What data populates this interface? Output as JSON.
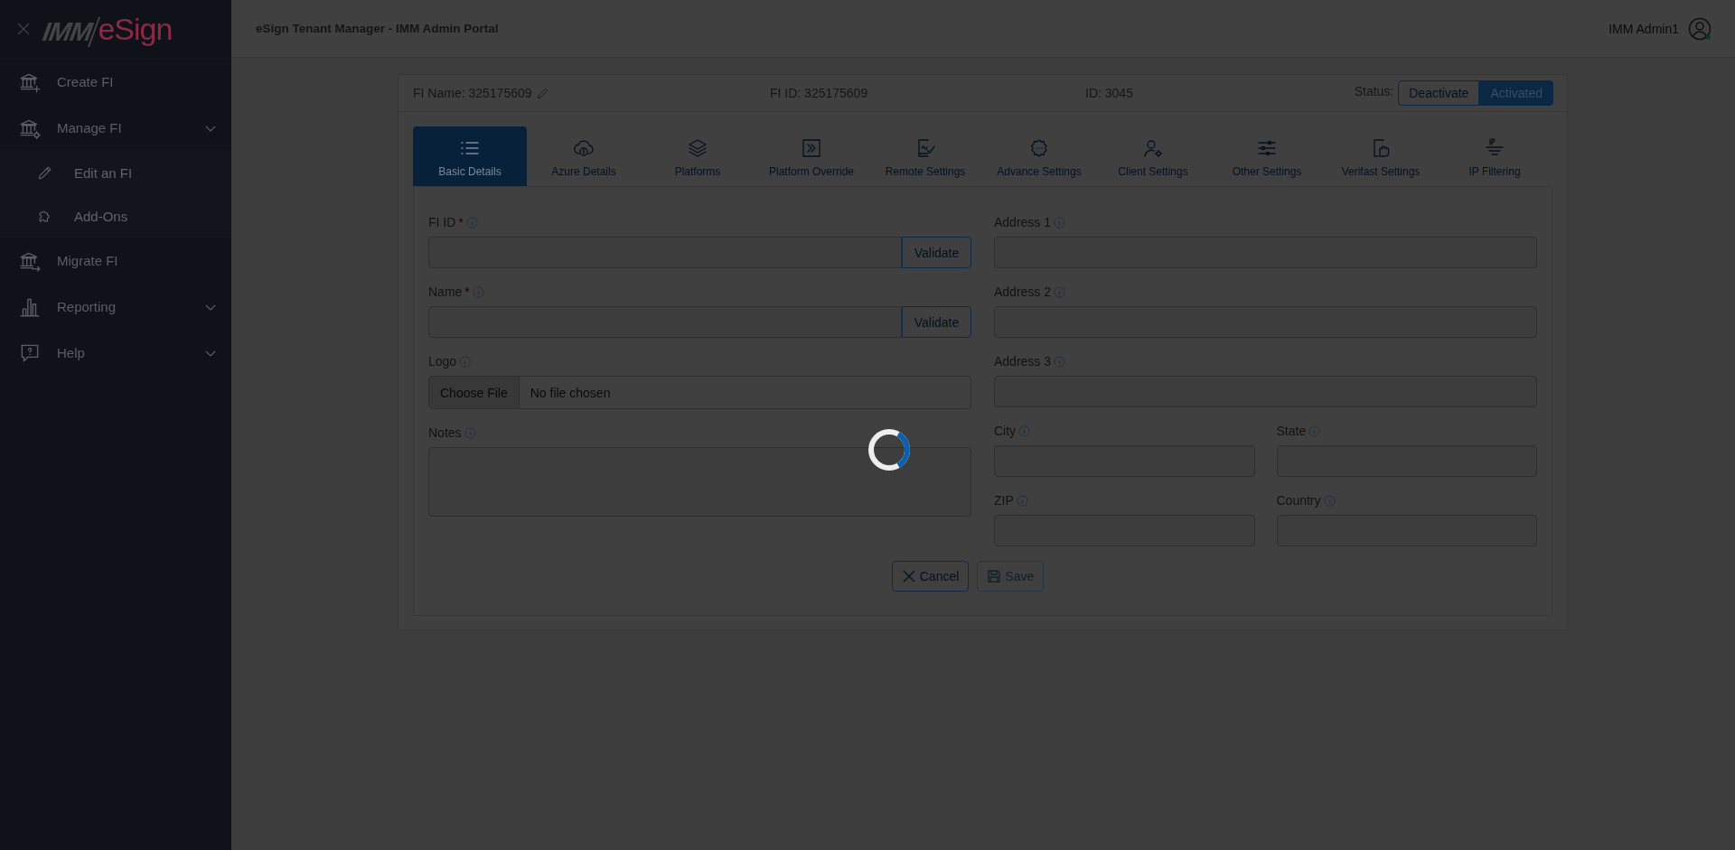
{
  "sidebar": {
    "logo": {
      "part_1": "IMM",
      "part_2": "eSign"
    },
    "items": [
      {
        "label": "Create FI",
        "kind": "link"
      },
      {
        "label": "Manage FI",
        "kind": "group",
        "children": [
          {
            "label": "Edit an FI"
          },
          {
            "label": "Add-Ons"
          }
        ]
      },
      {
        "label": "Migrate FI",
        "kind": "link"
      },
      {
        "label": "Reporting",
        "kind": "group"
      },
      {
        "label": "Help",
        "kind": "group"
      }
    ]
  },
  "header": {
    "title": "eSign Tenant Manager - IMM Admin Portal",
    "user": "IMM Admin1"
  },
  "card_header": {
    "fi_name": "FI Name: 325175609",
    "fi_id": "FI ID: 325175609",
    "id": "ID: 3045",
    "status_label": "Status:",
    "status_options": [
      {
        "label": "Deactivate",
        "selected": false
      },
      {
        "label": "Activated",
        "selected": true
      }
    ]
  },
  "tabs": [
    {
      "label": "Basic Details",
      "selected": true
    },
    {
      "label": "Azure Details",
      "selected": false
    },
    {
      "label": "Platforms",
      "selected": false
    },
    {
      "label": "Platform Override",
      "selected": false
    },
    {
      "label": "Remote Settings",
      "selected": false
    },
    {
      "label": "Advance Settings",
      "selected": false
    },
    {
      "label": "Client Settings",
      "selected": false
    },
    {
      "label": "Other Settings",
      "selected": false
    },
    {
      "label": "Verifast Settings",
      "selected": false
    },
    {
      "label": "IP Filtering",
      "selected": false
    }
  ],
  "form": {
    "left": [
      {
        "kind": "validate",
        "label": "FI ID",
        "required_mark": "*",
        "button": "Validate"
      },
      {
        "kind": "validate",
        "label": "Name",
        "required_mark": "*",
        "button": "Validate"
      },
      {
        "kind": "file",
        "label": "Logo",
        "button": "Choose File",
        "value": "No file chosen"
      },
      {
        "kind": "textarea",
        "label": "Notes"
      }
    ],
    "right": [
      {
        "fields": [
          {
            "kind": "text",
            "label": "Address 1"
          }
        ]
      },
      {
        "fields": [
          {
            "kind": "text",
            "label": "Address 2"
          }
        ]
      },
      {
        "fields": [
          {
            "kind": "text",
            "label": "Address 3"
          }
        ]
      },
      {
        "fields": [
          {
            "kind": "text",
            "label": "City"
          },
          {
            "kind": "text",
            "label": "State"
          }
        ]
      },
      {
        "fields": [
          {
            "kind": "text",
            "label": "ZIP"
          },
          {
            "kind": "text",
            "label": "Country"
          }
        ]
      }
    ],
    "buttons": [
      {
        "label": "Cancel",
        "disabled": false
      },
      {
        "label": "Save",
        "disabled": true
      }
    ]
  },
  "loading": true
}
